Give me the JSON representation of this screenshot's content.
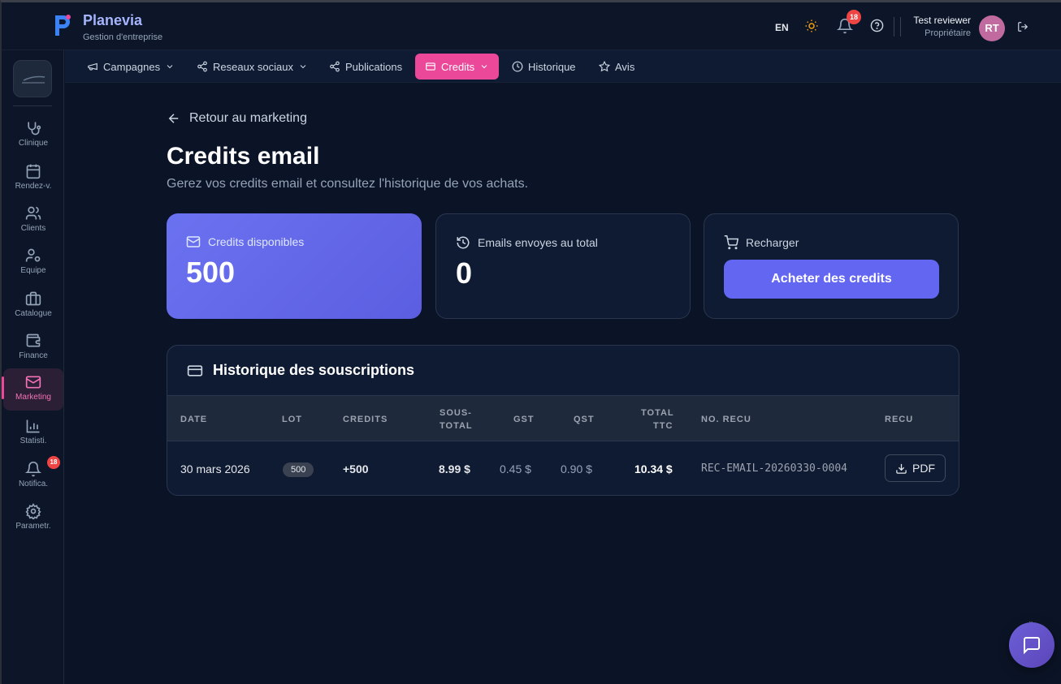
{
  "app": {
    "name": "Planevia",
    "subtitle": "Gestion d'entreprise"
  },
  "header": {
    "language": "EN",
    "notification_count": "18",
    "user_name": "Test reviewer",
    "user_role": "Propriétaire",
    "avatar_initials": "RT"
  },
  "sidebar": {
    "items": [
      {
        "label": "Clinique",
        "icon": "stethoscope-icon"
      },
      {
        "label": "Rendez-v.",
        "icon": "calendar-icon"
      },
      {
        "label": "Clients",
        "icon": "users-icon"
      },
      {
        "label": "Equipe",
        "icon": "user-cog-icon"
      },
      {
        "label": "Catalogue",
        "icon": "briefcase-icon"
      },
      {
        "label": "Finance",
        "icon": "wallet-icon"
      },
      {
        "label": "Marketing",
        "icon": "mail-icon",
        "active": true
      },
      {
        "label": "Statisti.",
        "icon": "bar-chart-icon"
      },
      {
        "label": "Notifica.",
        "icon": "bell-icon",
        "badge": "18"
      },
      {
        "label": "Parametr.",
        "icon": "gear-icon"
      }
    ]
  },
  "subnav": {
    "tabs": [
      {
        "label": "Campagnes",
        "icon": "megaphone-icon",
        "dropdown": true
      },
      {
        "label": "Reseaux sociaux",
        "icon": "share-icon",
        "dropdown": true
      },
      {
        "label": "Publications",
        "icon": "share-icon"
      },
      {
        "label": "Credits",
        "icon": "wallet-icon",
        "dropdown": true,
        "active": true
      },
      {
        "label": "Historique",
        "icon": "clock-icon"
      },
      {
        "label": "Avis",
        "icon": "star-icon"
      }
    ]
  },
  "page": {
    "back_label": "Retour au marketing",
    "title": "Credits email",
    "subtitle": "Gerez vos credits email et consultez l'historique de vos achats."
  },
  "cards": {
    "available": {
      "label": "Credits disponibles",
      "value": "500"
    },
    "sent": {
      "label": "Emails envoyes au total",
      "value": "0"
    },
    "recharge": {
      "label": "Recharger",
      "button": "Acheter des credits"
    }
  },
  "history": {
    "title": "Historique des souscriptions",
    "columns": [
      "DATE",
      "LOT",
      "CREDITS",
      "SOUS-",
      "TOTAL",
      "GST",
      "QST",
      "TOTAL",
      "TTC",
      "NO. RECU",
      "RECU"
    ],
    "rows": [
      {
        "date": "30 mars 2026",
        "lot": "500",
        "credits": "+500",
        "subtotal": "8.99 $",
        "gst": "0.45 $",
        "qst": "0.90 $",
        "total": "10.34 $",
        "receipt_no": "REC-EMAIL-20260330-0004",
        "receipt_btn": "PDF"
      }
    ]
  },
  "colors": {
    "accent": "#6366f1",
    "active_tab": "#ec4899",
    "background": "#0b1426"
  }
}
